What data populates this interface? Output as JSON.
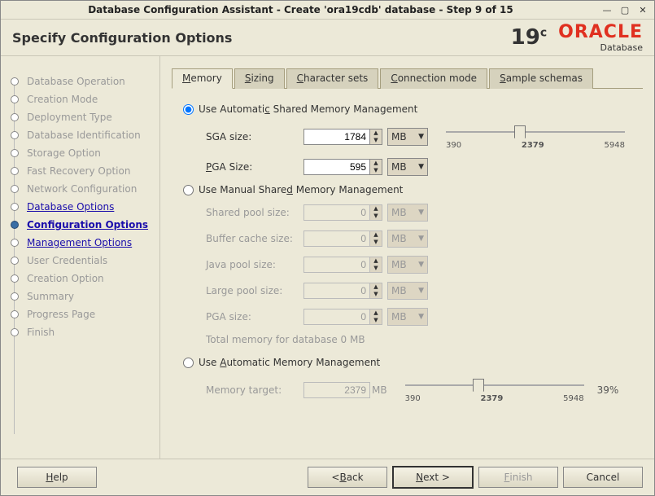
{
  "window": {
    "title": "Database Configuration Assistant - Create 'ora19cdb' database - Step 9 of 15"
  },
  "header": {
    "page_title": "Specify Configuration Options",
    "version": "19",
    "version_sup": "c",
    "brand": "ORACLE",
    "brand_sub": "Database"
  },
  "sidebar": {
    "items": [
      {
        "label": "Database Operation",
        "state": "done"
      },
      {
        "label": "Creation Mode",
        "state": "done"
      },
      {
        "label": "Deployment Type",
        "state": "done"
      },
      {
        "label": "Database Identification",
        "state": "done"
      },
      {
        "label": "Storage Option",
        "state": "done"
      },
      {
        "label": "Fast Recovery Option",
        "state": "done"
      },
      {
        "label": "Network Configuration",
        "state": "done"
      },
      {
        "label": "Database Options",
        "state": "link"
      },
      {
        "label": "Configuration Options",
        "state": "current"
      },
      {
        "label": "Management Options",
        "state": "link"
      },
      {
        "label": "User Credentials",
        "state": "todo"
      },
      {
        "label": "Creation Option",
        "state": "todo"
      },
      {
        "label": "Summary",
        "state": "todo"
      },
      {
        "label": "Progress Page",
        "state": "todo"
      },
      {
        "label": "Finish",
        "state": "todo"
      }
    ]
  },
  "tabs": {
    "items": [
      {
        "label": "Memory",
        "u": "M",
        "rest": "emory",
        "active": true
      },
      {
        "label": "Sizing",
        "u": "S",
        "rest": "izing"
      },
      {
        "label": "Character sets",
        "u": "C",
        "rest": "haracter sets"
      },
      {
        "label": "Connection mode",
        "u": "C",
        "rest": "onnection mode"
      },
      {
        "label": "Sample schemas",
        "u": "S",
        "rest": "ample schemas"
      }
    ]
  },
  "memory": {
    "opt_asmm": {
      "label_prefix": "Use Automati",
      "label_u": "c",
      "label_suffix": " Shared Memory Management",
      "selected": true
    },
    "sga": {
      "label": "SGA size:",
      "value": "1784",
      "unit": "MB"
    },
    "pga": {
      "label": "PGA Size:",
      "label_u": "P",
      "label_rest": "GA Size:",
      "value": "595",
      "unit": "MB"
    },
    "slider1": {
      "min": "390",
      "cur": "2379",
      "max": "5948"
    },
    "opt_manual": {
      "label_prefix": "Use Manual Share",
      "label_u": "d",
      "label_suffix": " Memory Management",
      "selected": false
    },
    "shared_pool": {
      "label": "Shared pool size:",
      "value": "0",
      "unit": "MB"
    },
    "buffer_cache": {
      "label": "Buffer cache size:",
      "value": "0",
      "unit": "MB"
    },
    "java_pool": {
      "label": "Java pool size:",
      "value": "0",
      "unit": "MB"
    },
    "large_pool": {
      "label": "Large pool size:",
      "label_u": "L",
      "label_rest": "arge pool size:",
      "value": "0",
      "unit": "MB"
    },
    "manual_pga": {
      "label": "PGA size:",
      "label_u": "P",
      "label_suffix": "GA size:",
      "value": "0",
      "unit": "MB"
    },
    "total": "Total memory for database 0 MB",
    "opt_amm": {
      "label_prefix": "Use ",
      "label_u": "A",
      "label_suffix": "utomatic Memory Management",
      "selected": false
    },
    "target": {
      "label": "Memory target:",
      "value": "2379",
      "unit": "MB"
    },
    "slider2": {
      "min": "390",
      "cur": "2379",
      "max": "5948",
      "pct": "39%"
    }
  },
  "footer": {
    "help": "Help",
    "help_u": "H",
    "help_rest": "elp",
    "back": "< Back",
    "back_u": "B",
    "back_pre": "< ",
    "back_rest": "ack",
    "next": "Next >",
    "next_u": "N",
    "next_rest": "ext >",
    "finish": "Finish",
    "finish_u": "F",
    "finish_rest": "inish",
    "cancel": "Cancel"
  }
}
